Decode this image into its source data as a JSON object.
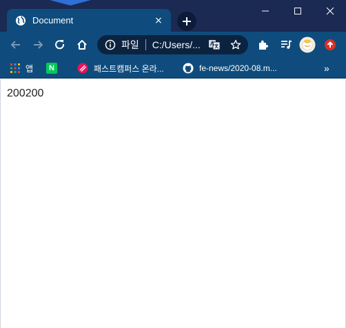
{
  "window": {
    "tab_title": "Document",
    "tab_close_label": "×",
    "new_tab_label": "+"
  },
  "toolbar": {
    "address_scheme": "파일",
    "address_url": "C:/Users/..."
  },
  "bookmarks": {
    "items": [
      {
        "label": "앱",
        "icon": "apps-grid-icon"
      },
      {
        "label": "",
        "icon": "naver-icon",
        "icon_text": "N"
      },
      {
        "label": "패스트캠퍼스 온라...",
        "icon": "fastcampus-icon"
      },
      {
        "label": "fe-news/2020-08.m...",
        "icon": "github-icon"
      }
    ],
    "overflow_label": "»"
  },
  "page": {
    "text": "200200"
  },
  "colors": {
    "titlebar": "#1b2a52",
    "tab_active": "#0f4c7d",
    "toolbar": "#0f4c7d",
    "omnibox": "#0c2340",
    "naver_green": "#03c75a",
    "fastcampus_red": "#e2155b",
    "update_red": "#d93025"
  }
}
